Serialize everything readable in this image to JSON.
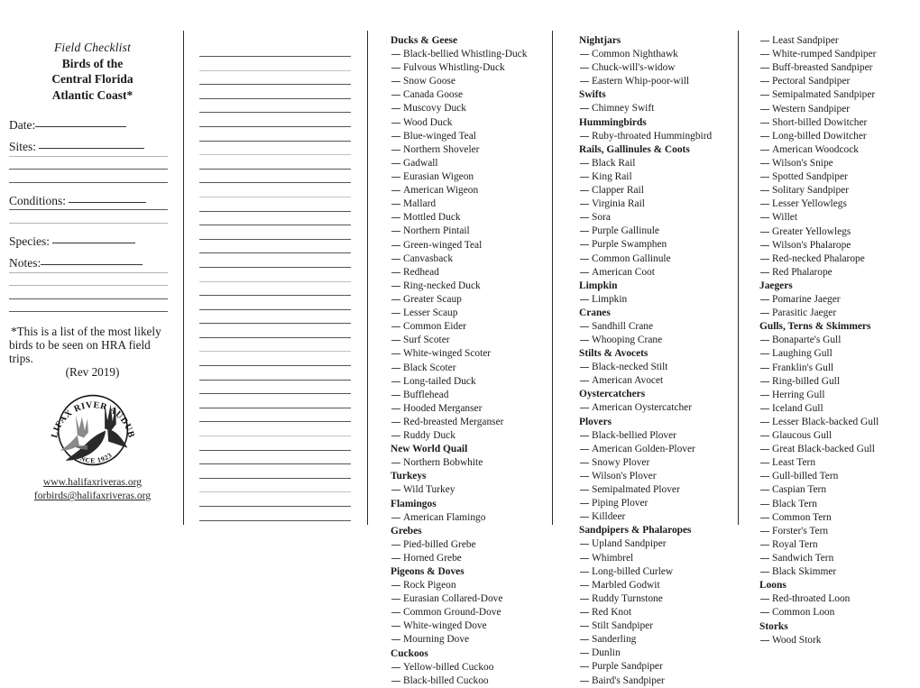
{
  "header": {
    "subtitle_italic": "Field Checklist",
    "title_line1": "Birds of the",
    "title_line2": "Central Florida",
    "title_line3": "Atlantic Coast*"
  },
  "form": {
    "date_label": "Date:",
    "sites_label": "Sites:",
    "conditions_label": "Conditions:",
    "species_label": "Species:",
    "notes_label": "Notes:"
  },
  "footnote": {
    "line1": "*This is a list of the most likely",
    "line2": "birds to be seen on HRA field trips.",
    "line3": "(Rev 2019)"
  },
  "logo": {
    "name": "halifax-river-audubon-seal",
    "arc_top_text": "HALIFAX  RIVER  AUDUBON",
    "arc_bottom_text": "SINCE 1923"
  },
  "links": {
    "website": "www.halifaxriveras.org",
    "email": "forbirds@halifaxriveras.org"
  },
  "lines_column": {
    "count": 34,
    "faint_indices": [
      1,
      7,
      10,
      16,
      21,
      27,
      31
    ]
  },
  "checklist": {
    "column3": [
      {
        "group": "Ducks & Geese",
        "species": [
          "Black-bellied Whistling-Duck",
          "Fulvous Whistling-Duck",
          "Snow Goose",
          "Canada Goose",
          "Muscovy Duck",
          "Wood Duck",
          "Blue-winged Teal",
          "Northern Shoveler",
          "Gadwall",
          "Eurasian Wigeon",
          "American Wigeon",
          "Mallard",
          "Mottled Duck",
          "Northern Pintail",
          "Green-winged Teal",
          "Canvasback",
          "Redhead",
          "Ring-necked Duck",
          "Greater Scaup",
          "Lesser Scaup",
          "Common Eider",
          "Surf Scoter",
          "White-winged Scoter",
          "Black Scoter",
          "Long-tailed Duck",
          "Bufflehead",
          "Hooded Merganser",
          "Red-breasted Merganser",
          "Ruddy Duck"
        ]
      },
      {
        "group": "New World Quail",
        "species": [
          "Northern Bobwhite"
        ]
      },
      {
        "group": "Turkeys",
        "species": [
          "Wild Turkey"
        ]
      },
      {
        "group": "Flamingos",
        "species": [
          "American Flamingo"
        ]
      },
      {
        "group": "Grebes",
        "species": [
          "Pied-billed Grebe",
          "Horned Grebe"
        ]
      },
      {
        "group": "Pigeons & Doves",
        "species": [
          "Rock Pigeon",
          "Eurasian Collared-Dove",
          "Common Ground-Dove",
          "White-winged Dove",
          "Mourning Dove"
        ]
      },
      {
        "group": "Cuckoos",
        "species": [
          "Yellow-billed Cuckoo",
          "Black-billed Cuckoo"
        ]
      }
    ],
    "column4": [
      {
        "group": "Nightjars",
        "species": [
          "Common Nighthawk",
          "Chuck-will's-widow",
          "Eastern Whip-poor-will"
        ]
      },
      {
        "group": "Swifts",
        "species": [
          "Chimney Swift"
        ]
      },
      {
        "group": "Hummingbirds",
        "species": [
          "Ruby-throated Hummingbird"
        ]
      },
      {
        "group": "Rails, Gallinules & Coots",
        "species": [
          "Black Rail",
          "King Rail",
          "Clapper Rail",
          "Virginia Rail",
          "Sora",
          "Purple Gallinule",
          "Purple Swamphen",
          "Common Gallinule",
          "American Coot"
        ]
      },
      {
        "group": "Limpkin",
        "species": [
          "Limpkin"
        ]
      },
      {
        "group": "Cranes",
        "species": [
          "Sandhill Crane",
          "Whooping Crane"
        ]
      },
      {
        "group": "Stilts & Avocets",
        "species": [
          "Black-necked Stilt",
          "American Avocet"
        ]
      },
      {
        "group": "Oystercatchers",
        "species": [
          "American Oystercatcher"
        ]
      },
      {
        "group": "Plovers",
        "species": [
          "Black-bellied Plover",
          "American Golden-Plover",
          "Snowy Plover",
          "Wilson's Plover",
          "Semipalmated Plover",
          "Piping Plover",
          "Killdeer"
        ]
      },
      {
        "group": "Sandpipers & Phalaropes",
        "species": [
          "Upland Sandpiper",
          "Whimbrel",
          "Long-billed Curlew",
          "Marbled Godwit",
          "Ruddy Turnstone",
          "Red Knot",
          "Stilt Sandpiper",
          "Sanderling",
          "Dunlin",
          "Purple Sandpiper",
          "Baird's Sandpiper"
        ]
      }
    ],
    "column5": [
      {
        "group": "",
        "species": [
          "Least Sandpiper",
          "White-rumped Sandpiper",
          "Buff-breasted Sandpiper",
          "Pectoral Sandpiper",
          "Semipalmated Sandpiper",
          "Western Sandpiper",
          "Short-billed Dowitcher",
          "Long-billed Dowitcher",
          "American Woodcock",
          "Wilson's Snipe",
          "Spotted Sandpiper",
          "Solitary Sandpiper",
          "Lesser Yellowlegs",
          "Willet",
          "Greater Yellowlegs",
          "Wilson's Phalarope",
          "Red-necked Phalarope",
          "Red Phalarope"
        ]
      },
      {
        "group": "Jaegers",
        "species": [
          "Pomarine Jaeger",
          "Parasitic Jaeger"
        ]
      },
      {
        "group": "Gulls, Terns & Skimmers",
        "species": [
          "Bonaparte's Gull",
          "Laughing Gull",
          "Franklin's Gull",
          "Ring-billed Gull",
          "Herring Gull",
          "Iceland Gull",
          "Lesser Black-backed Gull",
          "Glaucous Gull",
          "Great Black-backed Gull",
          "Least Tern",
          "Gull-billed Tern",
          "Caspian Tern",
          "Black Tern",
          "Common Tern",
          "Forster's Tern",
          "Royal Tern",
          "Sandwich Tern",
          "Black Skimmer"
        ]
      },
      {
        "group": "Loons",
        "species": [
          "Red-throated Loon",
          "Common Loon"
        ]
      },
      {
        "group": "Storks",
        "species": [
          "Wood Stork"
        ]
      }
    ]
  }
}
